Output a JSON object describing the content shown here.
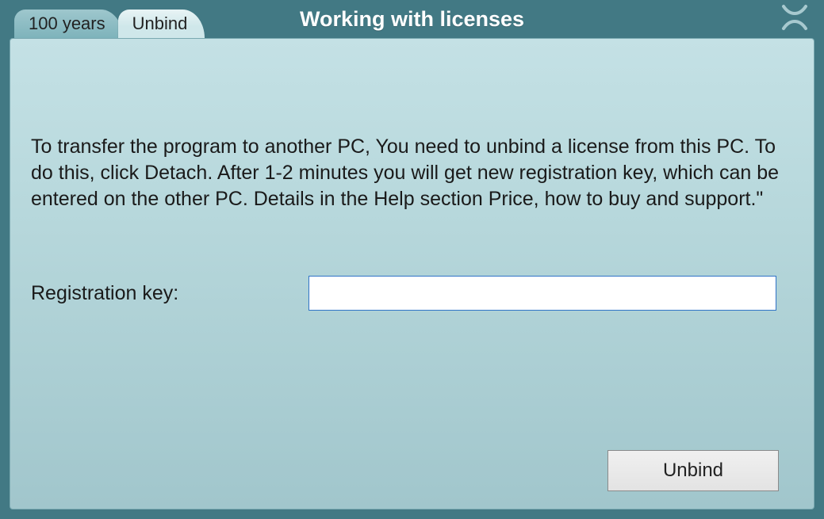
{
  "window": {
    "title": "Working with licenses"
  },
  "tabs": {
    "inactive": "100 years",
    "active": "Unbind"
  },
  "body": {
    "instructions": "To transfer the program to another PC, You need to unbind a license from this PC. To do this, click Detach. After 1-2 minutes you will get new registration key, which can be entered on the other PC. Details in the Help section Price, how to buy and support.\"",
    "key_label": "Registration key:",
    "key_value": "",
    "button": "Unbind"
  }
}
